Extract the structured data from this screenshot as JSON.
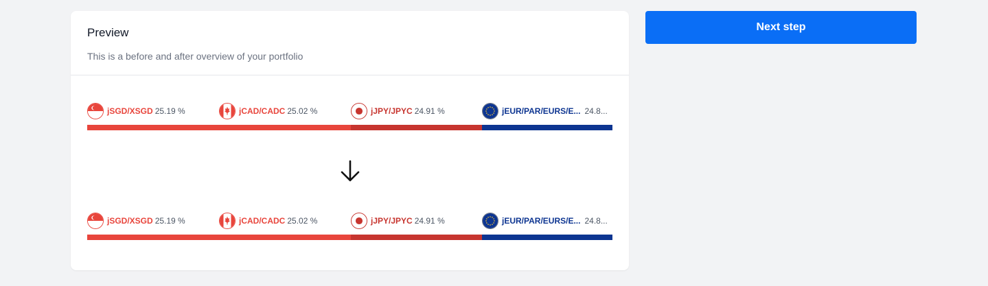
{
  "preview": {
    "title": "Preview",
    "subtitle": "This is a before and after overview of your portfolio"
  },
  "colors": {
    "singapore": "#e8453c",
    "canada": "#e8453c",
    "japan": "#c7352f",
    "euro": "#0d3591",
    "button": "#0a6ef6"
  },
  "before": {
    "items": [
      {
        "symbol": "jSGD/XSGD",
        "percent": "25.19 %",
        "icon": "singapore-flag-icon"
      },
      {
        "symbol": "jCAD/CADC",
        "percent": "25.02 %",
        "icon": "canada-flag-icon"
      },
      {
        "symbol": "jJPY/JPYC",
        "percent": "24.91 %",
        "icon": "japan-flag-icon"
      },
      {
        "symbol": "jEUR/PAR/EURS/E...",
        "percent": "24.8...",
        "icon": "eu-flag-icon"
      }
    ],
    "shares": [
      25.19,
      25.02,
      24.91,
      24.88
    ]
  },
  "arrow_icon": "arrow-down-icon",
  "after": {
    "items": [
      {
        "symbol": "jSGD/XSGD",
        "percent": "25.19 %",
        "icon": "singapore-flag-icon"
      },
      {
        "symbol": "jCAD/CADC",
        "percent": "25.02 %",
        "icon": "canada-flag-icon"
      },
      {
        "symbol": "jJPY/JPYC",
        "percent": "24.91 %",
        "icon": "japan-flag-icon"
      },
      {
        "symbol": "jEUR/PAR/EURS/E...",
        "percent": "24.8...",
        "icon": "eu-flag-icon"
      }
    ],
    "shares": [
      25.19,
      25.02,
      24.91,
      24.88
    ]
  },
  "next_button": {
    "label": "Next step"
  }
}
